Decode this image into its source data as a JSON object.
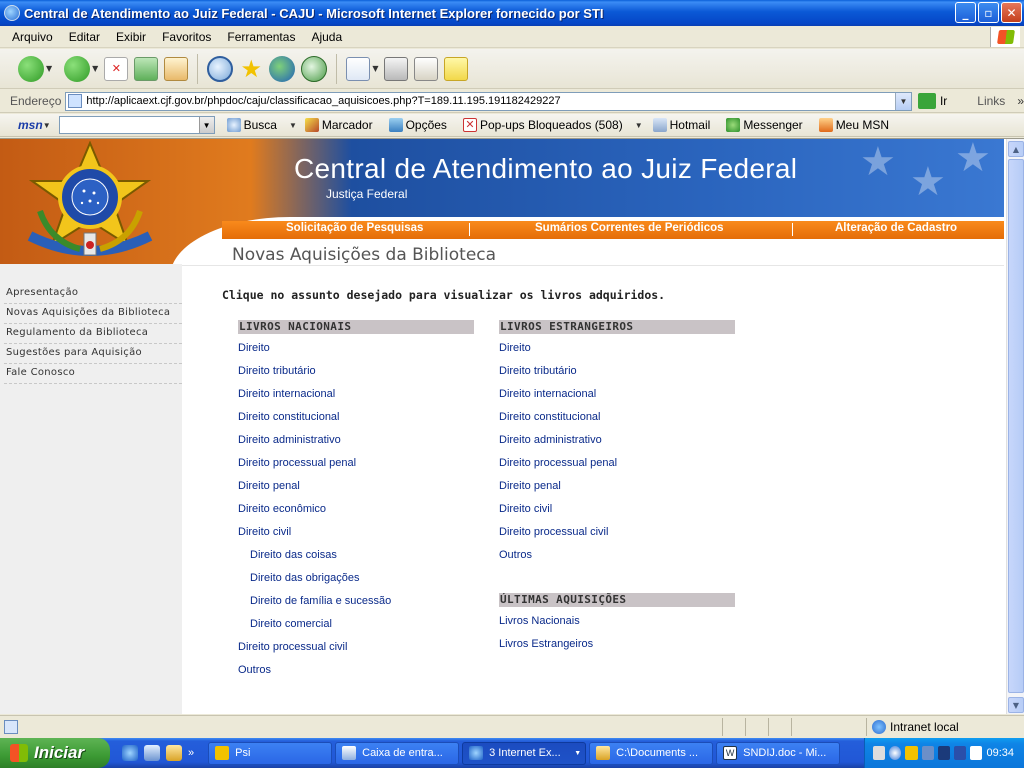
{
  "window": {
    "title": "Central de Atendimento ao Juiz Federal - CAJU - Microsoft Internet Explorer fornecido por STI"
  },
  "menu": [
    "Arquivo",
    "Editar",
    "Exibir",
    "Favoritos",
    "Ferramentas",
    "Ajuda"
  ],
  "address": {
    "label": "Endereço",
    "url": "http://aplicaext.cjf.gov.br/phpdoc/caju/classificacao_aquisicoes.php?T=189.11.195.191182429227",
    "go_label": "Ir",
    "links_label": "Links"
  },
  "msn_toolbar": {
    "logo": "msn",
    "search_label": "Busca",
    "highlight_label": "Marcador",
    "options_label": "Opções",
    "popups_label": "Pop-ups Bloqueados (508)",
    "hotmail_label": "Hotmail",
    "messenger_label": "Messenger",
    "mymsn_label": "Meu MSN"
  },
  "page": {
    "header_title": "Central de Atendimento ao Juiz Federal",
    "header_subtitle": "Justiça Federal",
    "nav": [
      "Solicitação de Pesquisas",
      "Sumários Correntes de Periódicos",
      "Alteração de Cadastro"
    ],
    "page_title": "Novas Aquisições da Biblioteca",
    "sidebar": [
      "Apresentação",
      "Novas Aquisições da Biblioteca",
      "Regulamento da Biblioteca",
      "Sugestões para Aquisição",
      "Fale Conosco"
    ],
    "intro": "Clique no assunto desejado para visualizar os livros adquiridos.",
    "nacionais": {
      "heading": "LIVROS NACIONAIS",
      "links": [
        {
          "label": "Direito",
          "sub": false
        },
        {
          "label": "Direito tributário",
          "sub": false
        },
        {
          "label": "Direito internacional",
          "sub": false
        },
        {
          "label": "Direito constitucional",
          "sub": false
        },
        {
          "label": "Direito administrativo",
          "sub": false
        },
        {
          "label": "Direito processual penal",
          "sub": false
        },
        {
          "label": "Direito penal",
          "sub": false
        },
        {
          "label": "Direito econômico",
          "sub": false
        },
        {
          "label": "Direito civil",
          "sub": false
        },
        {
          "label": "Direito das coisas",
          "sub": true
        },
        {
          "label": "Direito das obrigações",
          "sub": true
        },
        {
          "label": "Direito de família e sucessão",
          "sub": true
        },
        {
          "label": "Direito comercial",
          "sub": true
        },
        {
          "label": "Direito processual civil",
          "sub": false
        },
        {
          "label": "Outros",
          "sub": false
        }
      ]
    },
    "estrangeiros": {
      "heading": "LIVROS ESTRANGEIROS",
      "links": [
        "Direito",
        "Direito tributário",
        "Direito internacional",
        "Direito constitucional",
        "Direito administrativo",
        "Direito processual penal",
        "Direito penal",
        "Direito civil",
        "Direito processual civil",
        "Outros"
      ]
    },
    "ultimas": {
      "heading": "ÚLTIMAS AQUISIÇÕES",
      "links": [
        "Livros Nacionais",
        "Livros Estrangeiros"
      ]
    }
  },
  "status": {
    "zone": "Intranet local"
  },
  "taskbar": {
    "start": "Iniciar",
    "tasks": [
      "Psi",
      "Caixa de entra...",
      "3 Internet Ex...",
      "C:\\Documents ...",
      "SNDIJ.doc - Mi..."
    ],
    "clock": "09:34"
  },
  "colors": {
    "link": "#0a2a8a",
    "nav_orange": "#f07a12",
    "header_blue": "#2a64bd",
    "section_head_bg": "#c9c3c6"
  }
}
